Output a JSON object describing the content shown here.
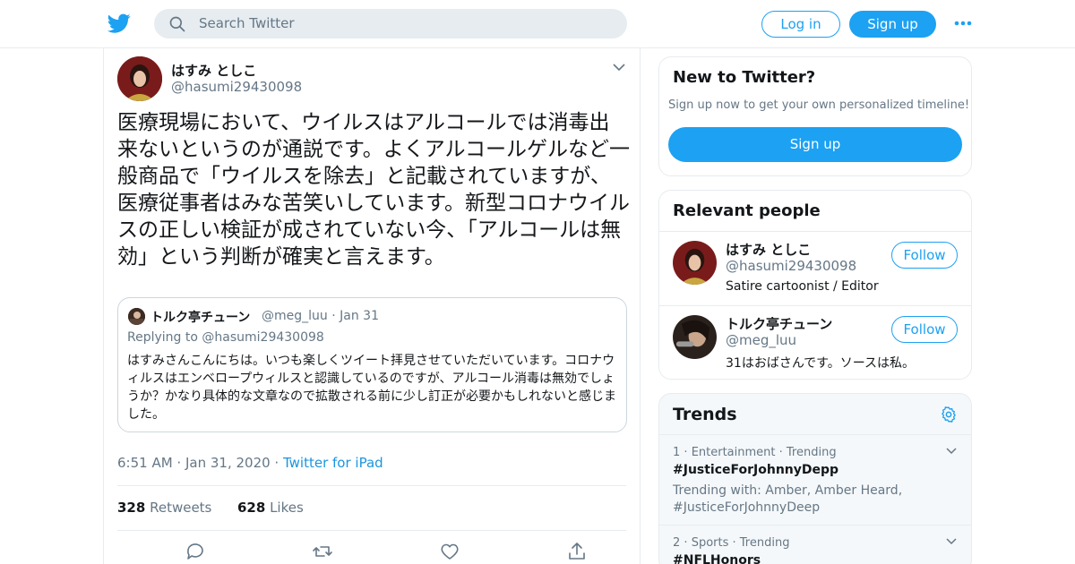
{
  "header": {
    "search_placeholder": "Search Twitter",
    "login_label": "Log in",
    "signup_label": "Sign up",
    "logo_icon": "twitter-bird-icon",
    "more_icon": "more-dots-icon"
  },
  "tweet": {
    "author_name": "はすみ としこ",
    "author_handle": "@hasumi29430098",
    "text": "医療現場において、ウイルスはアルコールでは消毒出来ないというのが通説です。よくアルコールゲルなど一般商品で「ウイルスを除去」と記載されていますが、医療従事者はみな苦笑いしています。新型コロナウイルスの正しい検証が成されていない今、「アルコールは無効」という判断が確実と言えます。",
    "time": "6:51 AM",
    "date": "Jan 31, 2020",
    "source": "Twitter for iPad",
    "retweets_count": "328",
    "retweets_label": "Retweets",
    "likes_count": "628",
    "likes_label": "Likes",
    "quoted": {
      "author_name": "トルク亭チューン",
      "author_handle": "@meg_luu",
      "date": "Jan 31",
      "replying_to_label": "Replying to",
      "replying_to_handle": "@hasumi29430098",
      "text": "はすみさんこんにちは。いつも楽しくツイート拝見させていただいています。コロナウィルスはエンベロープウィルスと認識しているのですが、アルコール消毒は無効でしょうか？かなり具体的な文章なので拡散される前に少し訂正が必要かもしれないと感じました。"
    }
  },
  "new_to_twitter": {
    "title": "New to Twitter?",
    "subtitle": "Sign up now to get your own personalized timeline!",
    "signup_label": "Sign up"
  },
  "relevant_people": {
    "title": "Relevant people",
    "people": [
      {
        "name": "はすみ としこ",
        "handle": "@hasumi29430098",
        "bio": "Satire cartoonist / Editor",
        "follow_label": "Follow"
      },
      {
        "name": "トルク亭チューン",
        "handle": "@meg_luu",
        "bio": "31はおばさんです。ソースは私。",
        "follow_label": "Follow"
      }
    ]
  },
  "trends": {
    "title": "Trends",
    "items": [
      {
        "rank": "1",
        "category": "Entertainment",
        "status": "Trending",
        "name": "#JusticeForJohnnyDepp",
        "with_text": "Trending with: Amber, Amber Heard, #JusticeForJohnnyDeep"
      },
      {
        "rank": "2",
        "category": "Sports",
        "status": "Trending",
        "name": "#NFLHonors"
      }
    ]
  },
  "colors": {
    "brand": "#1da1f2",
    "link": "#1b95e0",
    "muted": "#657786",
    "border": "#e6ecf0"
  }
}
